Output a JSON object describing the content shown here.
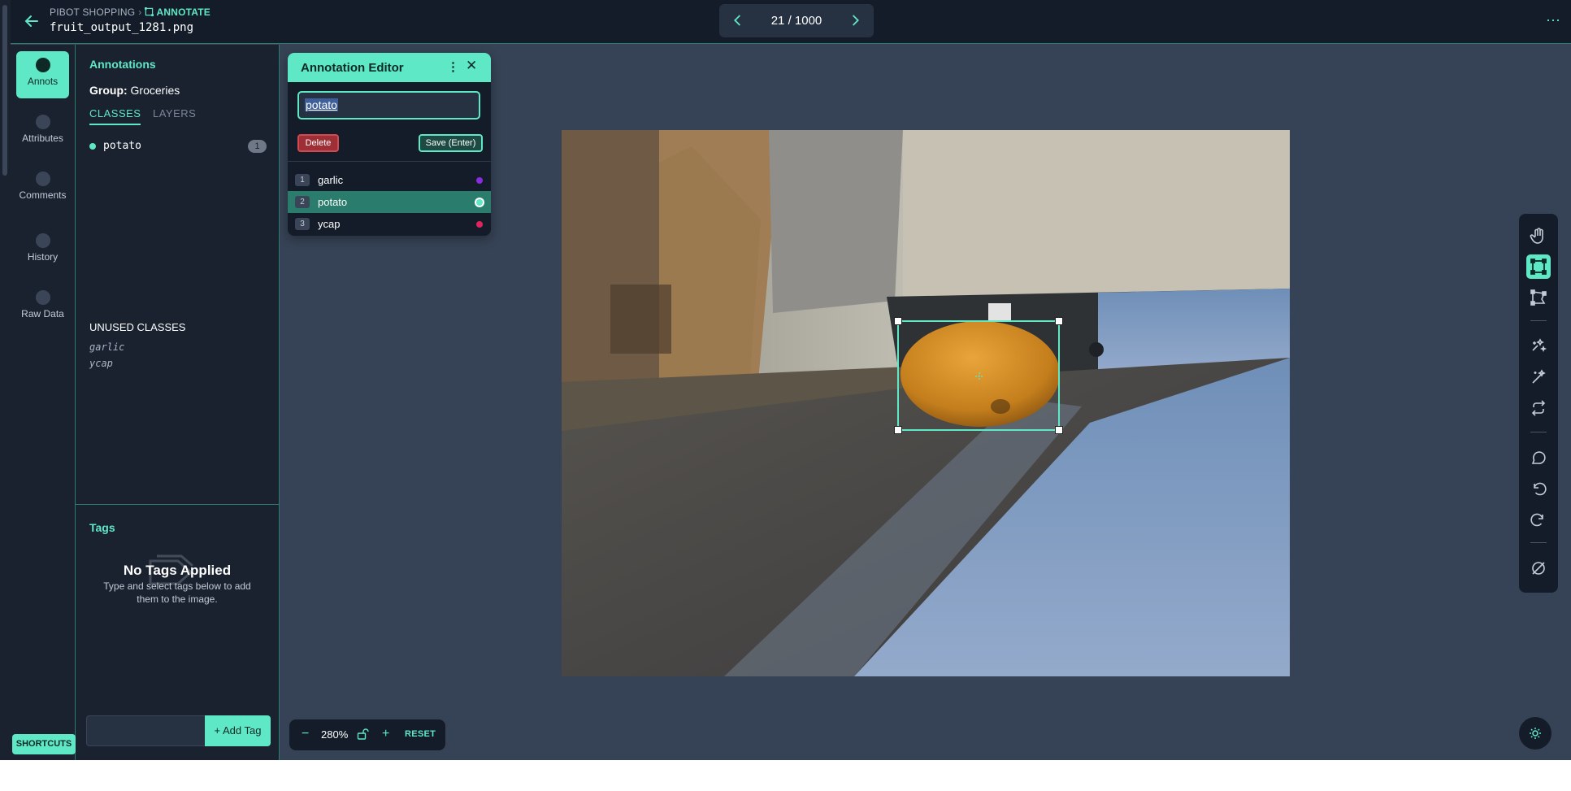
{
  "header": {
    "project": "PIBOT SHOPPING",
    "section": "ANNOTATE",
    "filename": "fruit_output_1281.png",
    "pager": "21 / 1000",
    "more": "⋯"
  },
  "rail": {
    "items": [
      {
        "label": "Annots",
        "icon": "annotations-icon"
      },
      {
        "label": "Attributes",
        "icon": "attributes-icon"
      },
      {
        "label": "Comments",
        "icon": "comments-icon"
      },
      {
        "label": "History",
        "icon": "history-icon"
      },
      {
        "label": "Raw Data",
        "icon": "raw-data-icon"
      }
    ],
    "shortcuts": "SHORTCUTS"
  },
  "panel": {
    "title": "Annotations",
    "group_label": "Group:",
    "group_value": "Groceries",
    "tabs": [
      "CLASSES",
      "LAYERS"
    ],
    "classes": [
      {
        "name": "potato",
        "count": "1",
        "color": "#5fe8c6"
      }
    ],
    "unused_title": "UNUSED CLASSES",
    "unused": [
      "garlic",
      "ycap"
    ],
    "tags": {
      "title": "Tags",
      "empty_title": "No Tags Applied",
      "empty_desc": "Type and select tags below to add them to the image.",
      "add_button": "+ Add Tag",
      "input_value": ""
    }
  },
  "editor": {
    "title": "Annotation Editor",
    "more": "⋮",
    "close": "✕",
    "input_value": "potato",
    "delete_label": "Delete",
    "save_label": "Save (Enter)",
    "options": [
      {
        "num": "1",
        "label": "garlic",
        "color": "#8a2be2",
        "selected": false
      },
      {
        "num": "2",
        "label": "potato",
        "color": "#5fe8c6",
        "selected": true
      },
      {
        "num": "3",
        "label": "ycap",
        "color": "#e0245e",
        "selected": false
      }
    ]
  },
  "zoom": {
    "minus": "−",
    "value": "280%",
    "plus": "+",
    "reset": "RESET"
  },
  "colors": {
    "accent": "#5fe8c6",
    "header_bg": "#141c29",
    "panel_bg": "#1a2230",
    "canvas_bg": "#364356"
  }
}
